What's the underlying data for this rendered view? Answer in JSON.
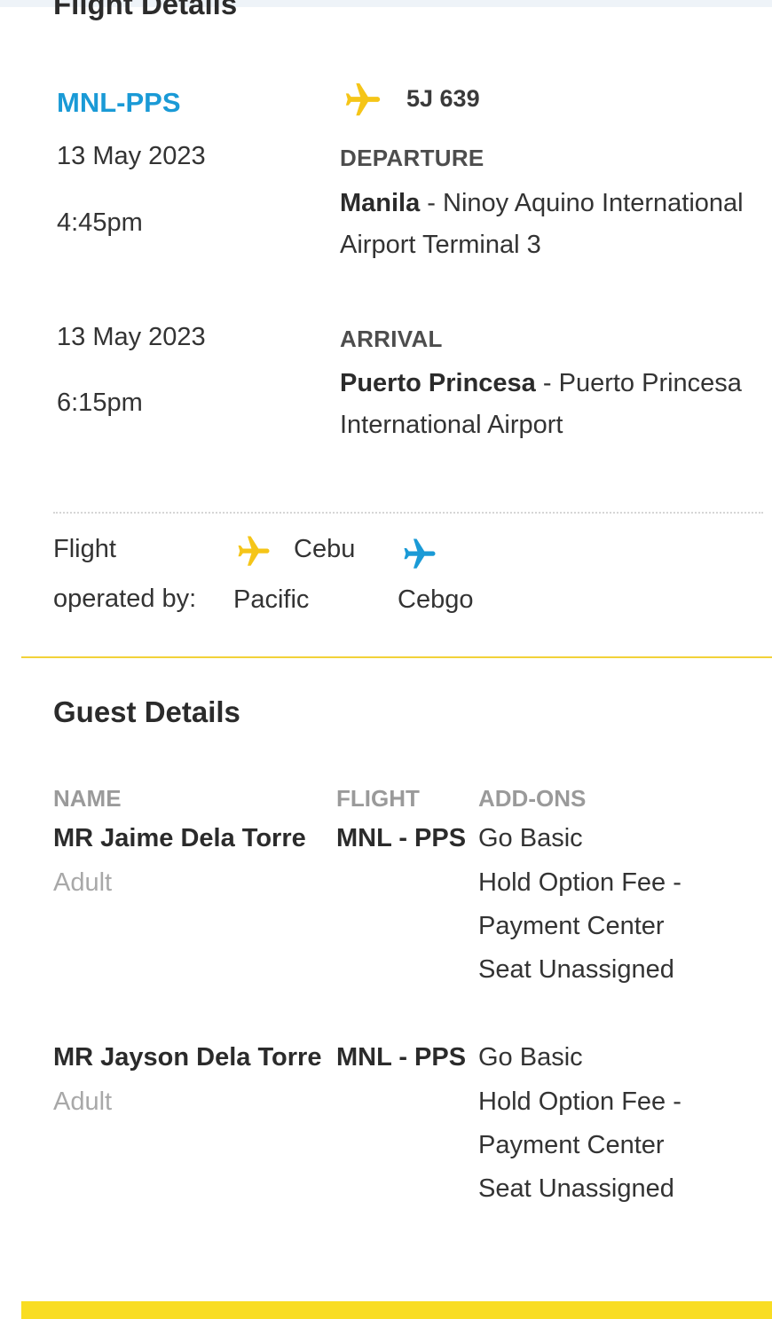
{
  "flight_details": {
    "title": "Flight Details",
    "route_code": "MNL-PPS",
    "flight_number": "5J 639",
    "departure": {
      "date": "13 May 2023",
      "time": "4:45pm",
      "label": "DEPARTURE",
      "city": "Manila",
      "separator": " - ",
      "airport": "Ninoy Aquino International Airport Terminal 3"
    },
    "arrival": {
      "date": "13 May 2023",
      "time": "6:15pm",
      "label": "ARRIVAL",
      "city": "Puerto Princesa",
      "separator": " - ",
      "airport": "Puerto Princesa International Airport"
    },
    "operated_by": {
      "label_line1": "Flight",
      "label_line2": "operated by:",
      "carriers": [
        {
          "line1": "Cebu",
          "line2": "Pacific",
          "icon": "plane-icon",
          "color": "#f5c518"
        },
        {
          "line1": "",
          "line2": "Cebgo",
          "icon": "plane-icon",
          "color": "#1a9ad6"
        }
      ]
    }
  },
  "guest_details": {
    "title": "Guest Details",
    "columns": {
      "name": "NAME",
      "flight": "FLIGHT",
      "addons": "ADD-ONS"
    },
    "guests": [
      {
        "name": "MR Jaime Dela Torre",
        "type": "Adult",
        "flight": "MNL - PPS",
        "addons": [
          "Go Basic",
          "Hold Option Fee -",
          "Payment Center",
          "Seat Unassigned"
        ]
      },
      {
        "name": "MR Jayson Dela Torre",
        "type": "Adult",
        "flight": "MNL - PPS",
        "addons": [
          "Go Basic",
          "Hold Option Fee -",
          "Payment Center",
          "Seat Unassigned"
        ]
      }
    ]
  },
  "colors": {
    "brand_yellow": "#f5c518",
    "brand_blue": "#1a9ad6",
    "footer_yellow": "#f9dd23"
  }
}
